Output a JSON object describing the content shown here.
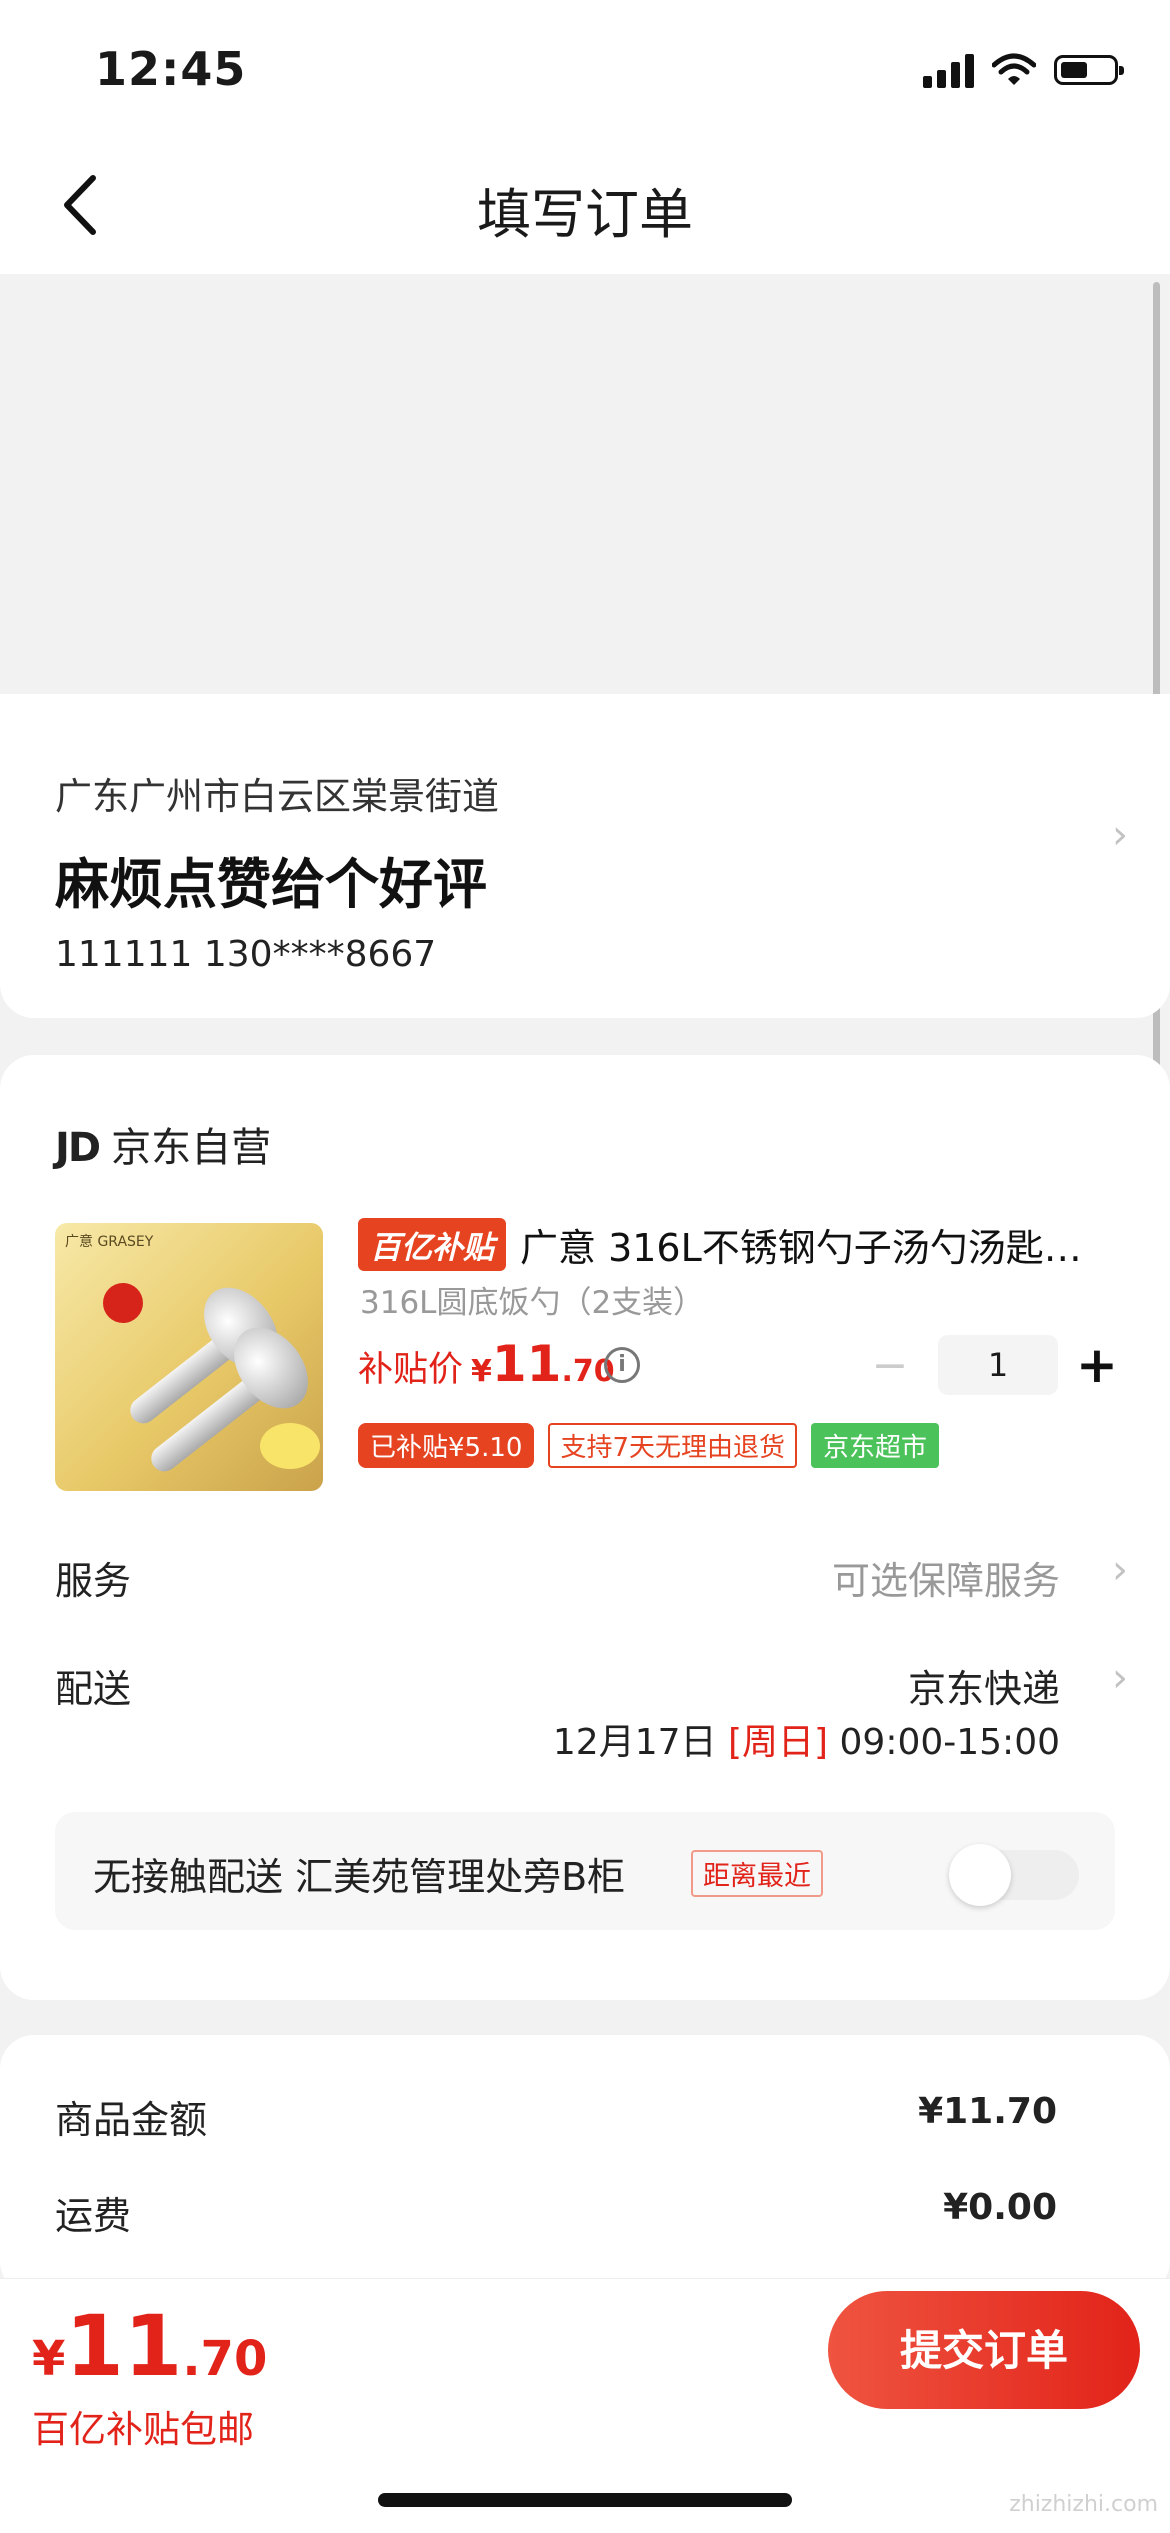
{
  "status_bar": {
    "time": "12:45"
  },
  "nav": {
    "title": "填写订单"
  },
  "address": {
    "region": "广东广州市白云区棠景街道",
    "detail": "麻烦点赞给个好评",
    "contact": "111111  130****8667"
  },
  "store": {
    "logo": "JD",
    "name": "京东自营"
  },
  "product": {
    "tag": "百亿补贴",
    "title": "广意 316L不锈钢勺子汤勺汤匙…",
    "spec": "316L圆底饭勺（2支装）",
    "price_label": "补贴价",
    "price_currency": "¥",
    "price_int": "11",
    "price_dec": ".70",
    "quantity": "1",
    "badge_subsidy": "已补贴¥5.10",
    "badge_return": "支持7天无理由退货",
    "badge_market": "京东超市",
    "image_brand": "广意 GRASEY"
  },
  "service": {
    "label": "服务",
    "value": "可选保障服务"
  },
  "delivery": {
    "label": "配送",
    "carrier": "京东快递",
    "date": "12月17日",
    "weekday": "[周日]",
    "window": "09:00-15:00"
  },
  "contactless": {
    "text": "无接触配送  汇美苑管理处旁B柜",
    "tag": "距离最近",
    "enabled": false
  },
  "summary": {
    "goods_label": "商品金额",
    "goods_value": "¥11.70",
    "freight_label": "运费",
    "freight_value": "¥0.00"
  },
  "footer": {
    "currency": "¥",
    "total_int": "11",
    "total_dec": ".70",
    "shipping_note": "百亿补贴包邮",
    "submit_label": "提交订单"
  },
  "watermark": "zhizhizhi.com",
  "colors": {
    "accent": "#e2231a",
    "badge_green": "#4cc25a"
  }
}
